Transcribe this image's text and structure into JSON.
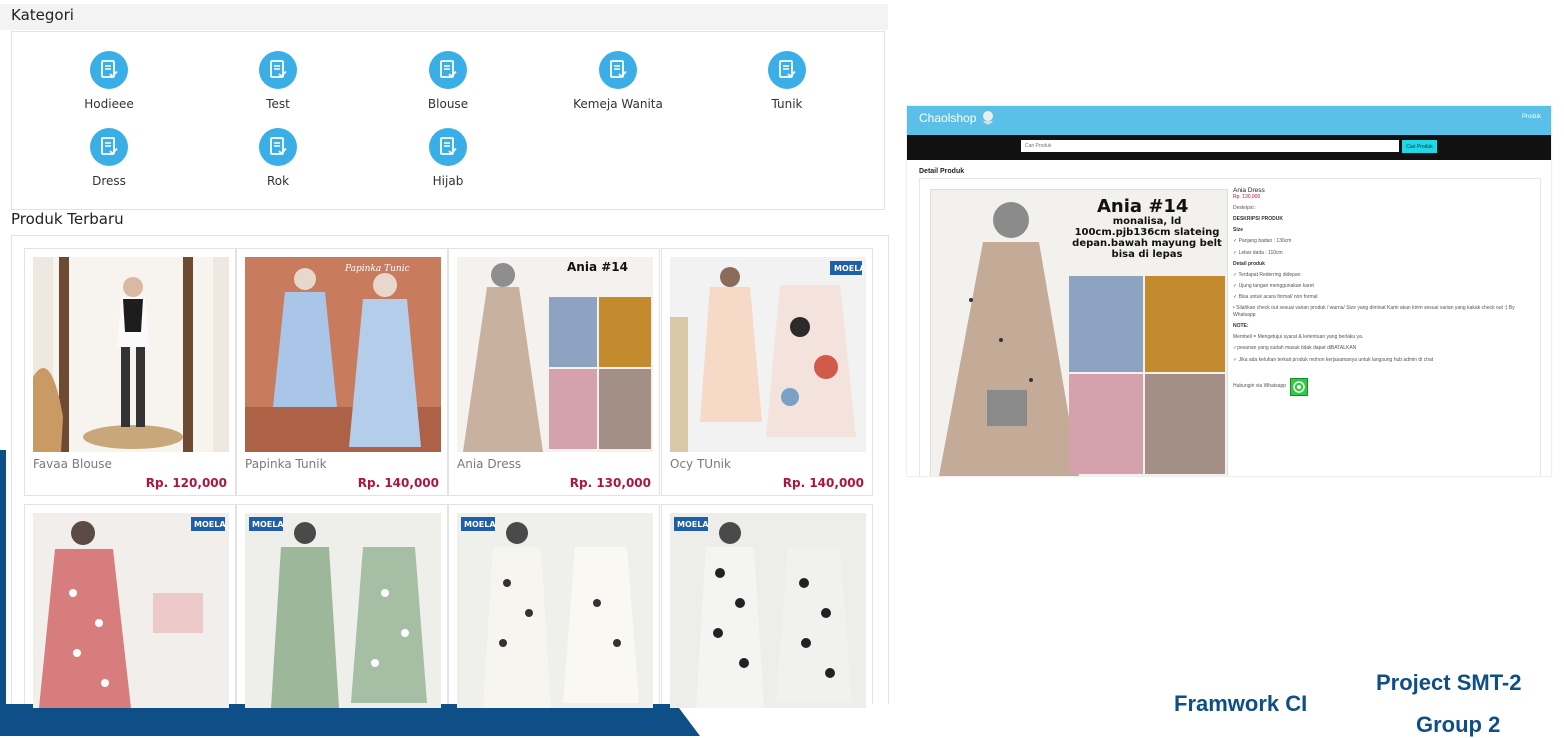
{
  "kategori": {
    "title": "Kategori",
    "items": [
      {
        "label": "Hodieee"
      },
      {
        "label": "Test"
      },
      {
        "label": "Blouse"
      },
      {
        "label": "Kemeja Wanita"
      },
      {
        "label": "Tunik"
      },
      {
        "label": "Dress"
      },
      {
        "label": "Rok"
      },
      {
        "label": "Hijab"
      }
    ],
    "icon": "document-check-icon",
    "icon_color": "#3aaee6"
  },
  "produk": {
    "title": "Produk Terbaru",
    "cards": [
      {
        "name": "Favaa Blouse",
        "price": "Rp. 120,000"
      },
      {
        "name": "Papinka Tunik",
        "price": "Rp. 140,000",
        "image_text": "Papinka Tunic"
      },
      {
        "name": "Ania Dress",
        "price": "Rp. 130,000",
        "image_text": "Ania #14"
      },
      {
        "name": "Ocy TUnik",
        "price": "Rp. 140,000",
        "image_text": "MOELA"
      },
      {
        "name": "",
        "price": "",
        "image_text": "MOELA"
      },
      {
        "name": "",
        "price": "",
        "image_text": "MOELA"
      },
      {
        "name": "",
        "price": "",
        "image_text": "MOELA"
      },
      {
        "name": "",
        "price": "",
        "image_text": "MOELA"
      }
    ],
    "price_color": "#b0143e"
  },
  "detail": {
    "brand": "Chaolshop",
    "nav_link": "Produk",
    "search_placeholder": "Cari Produk",
    "search_button": "Cari Produk",
    "section_title": "Detail Produk",
    "image_caption_title": "Ania #14",
    "image_caption_text": "monalisa, ld 100cm.pjb136cm slateing depan.bawah mayung belt bisa di lepas",
    "product_name": "Ania Dress",
    "price": "Rp. 130,000",
    "deskripsi_label": "Deskripsi :",
    "heading": "DESKRIPSI PRODUK",
    "size_label": "Size",
    "size_lines": [
      "Panjang badan : 136cm",
      "Lebar dada : 110cm"
    ],
    "detail_label": "Detail produk",
    "detail_lines": [
      "Terdapat Rederring didepan",
      "Ujung tangan menggunakan karet",
      "Bisa untuk acara formal/ non formal"
    ],
    "order_note": "• Silahkan check out sesuai varian produk / warna/ Size yang diminat Kami akan kirim sesuai varian yang kakak check out :) By Whatsapp",
    "note_label": "NOTE:",
    "note_lines": [
      "Membeli = Mengetujui syarat & ketentuan yang berlaku ya.",
      "pesanan yang sudah masuk tidak dapat diBATALKAN",
      "Jika ada keluhan terkait produk mohon kerjasamanya untuk langsung hub admin di chat"
    ],
    "contact_label": "Hubungin via Whatsapp",
    "header_color": "#5bc0e8"
  },
  "footer": {
    "framework": "Framwork CI",
    "project": "Project SMT-2",
    "group": "Group 2",
    "accent": "#0d4f86"
  }
}
